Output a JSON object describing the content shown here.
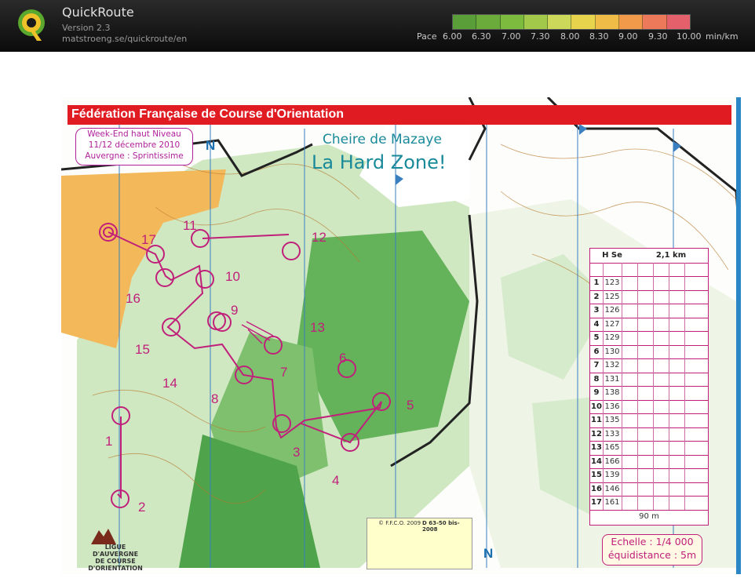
{
  "app": {
    "name": "QuickRoute",
    "version": "Version 2.3",
    "url": "matstroeng.se/quickroute/en"
  },
  "pace_scale": {
    "label": "Pace",
    "unit": "min/km",
    "ticks": [
      "6.00",
      "6.30",
      "7.00",
      "7.30",
      "8.00",
      "8.30",
      "9.00",
      "9.30",
      "10.00"
    ],
    "colors": [
      "#5a9e3a",
      "#6aab3c",
      "#7dbb3f",
      "#a3c94a",
      "#cbd85a",
      "#e8d34d",
      "#efbd47",
      "#f09a4a",
      "#ec7a5a",
      "#e4606a"
    ]
  },
  "map": {
    "header": "Fédération Française de Course d'Orientation",
    "event_lines": [
      "Week-End haut Niveau",
      "11/12 décembre 2010",
      "Auvergne : Sprintissime"
    ],
    "title_line1": "Cheire de Mazaye",
    "title_line2": "La Hard Zone!",
    "control_labels": [
      {
        "n": "1"
      },
      {
        "n": "2"
      },
      {
        "n": "3"
      },
      {
        "n": "4"
      },
      {
        "n": "5"
      },
      {
        "n": "6"
      },
      {
        "n": "7"
      },
      {
        "n": "8"
      },
      {
        "n": "9"
      },
      {
        "n": "10"
      },
      {
        "n": "11"
      },
      {
        "n": "12"
      },
      {
        "n": "13"
      },
      {
        "n": "14"
      },
      {
        "n": "15"
      },
      {
        "n": "16"
      },
      {
        "n": "17"
      }
    ],
    "north_marker": "N",
    "scale_line1": "Echelle : 1/4 000",
    "scale_line2": "équidistance : 5m",
    "credit_left": "© F.F.C.O. 2009",
    "credit_right": "D 63-50 bis-2008",
    "league_lines": [
      "LIGUE D'AUVERGNE",
      "DE COURSE",
      "D'ORIENTATION"
    ]
  },
  "control_descriptions": {
    "class": "H Se",
    "length": "2,1 km",
    "finish": "90 m",
    "rows": [
      {
        "num": "1",
        "code": "123"
      },
      {
        "num": "2",
        "code": "125"
      },
      {
        "num": "3",
        "code": "126"
      },
      {
        "num": "4",
        "code": "127"
      },
      {
        "num": "5",
        "code": "129"
      },
      {
        "num": "6",
        "code": "130"
      },
      {
        "num": "7",
        "code": "132"
      },
      {
        "num": "8",
        "code": "131"
      },
      {
        "num": "9",
        "code": "138"
      },
      {
        "num": "10",
        "code": "136"
      },
      {
        "num": "11",
        "code": "135"
      },
      {
        "num": "12",
        "code": "133"
      },
      {
        "num": "13",
        "code": "165"
      },
      {
        "num": "14",
        "code": "166"
      },
      {
        "num": "15",
        "code": "139"
      },
      {
        "num": "16",
        "code": "146"
      },
      {
        "num": "17",
        "code": "161"
      }
    ]
  }
}
